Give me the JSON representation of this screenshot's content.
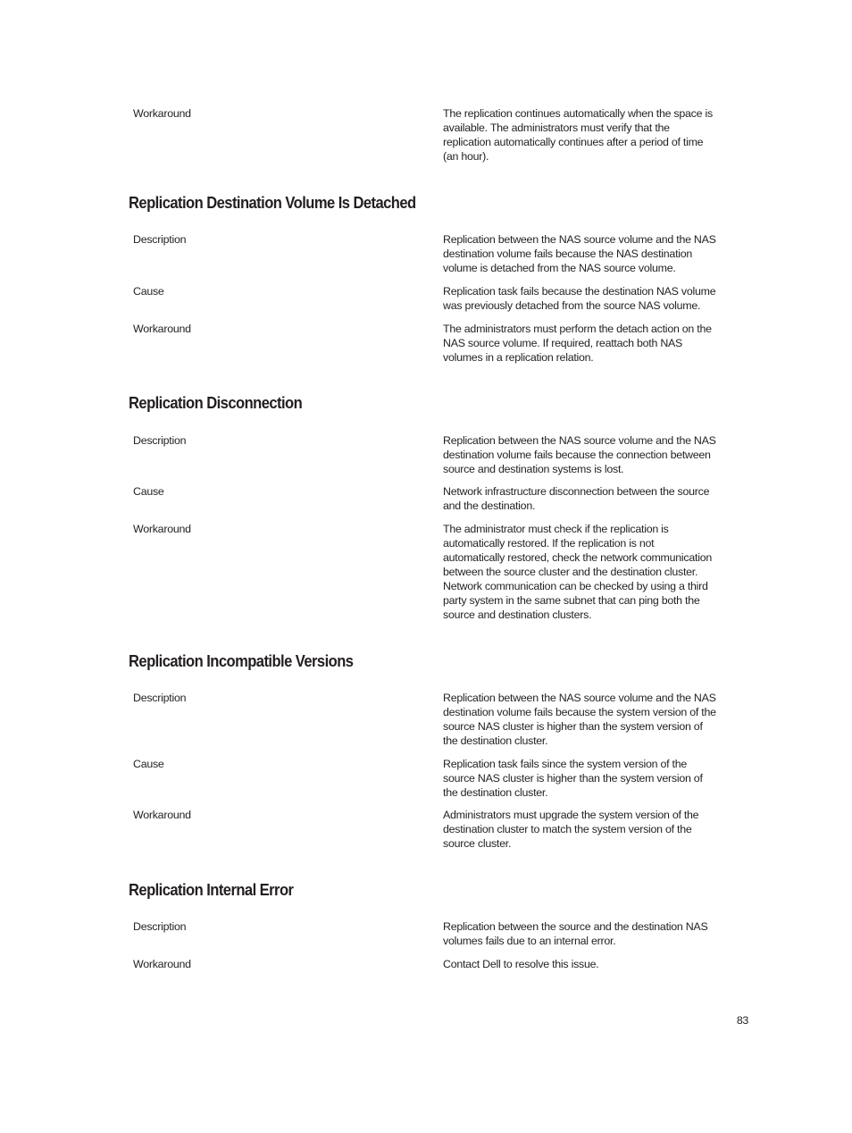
{
  "page_number": "83",
  "intro_row": {
    "label": "Workaround",
    "lines": [
      "The replication continues automatically when the space is",
      "available. The administrators must verify that the",
      "replication automatically continues after a period of time",
      "(an hour)."
    ]
  },
  "sections": [
    {
      "title": "Replication Destination Volume Is Detached",
      "rows": [
        {
          "label": "Description",
          "lines": [
            "Replication between the NAS source volume and the NAS",
            "destination volume fails because the NAS destination",
            "volume is detached from the NAS source volume."
          ]
        },
        {
          "label": "Cause",
          "lines": [
            "Replication task fails because the destination NAS volume",
            "was previously detached from the source NAS volume."
          ]
        },
        {
          "label": "Workaround",
          "lines": [
            "The administrators must perform the detach action on the",
            "NAS source volume. If required, reattach both NAS",
            "volumes in a replication relation."
          ]
        }
      ]
    },
    {
      "title": "Replication Disconnection",
      "rows": [
        {
          "label": "Description",
          "lines": [
            "Replication between the NAS source volume and the NAS",
            "destination volume fails because the connection between",
            "source and destination systems is lost."
          ]
        },
        {
          "label": "Cause",
          "lines": [
            "Network infrastructure disconnection between the source",
            "and the destination."
          ]
        },
        {
          "label": "Workaround",
          "lines": [
            "The administrator must check if the replication is",
            "automatically restored. If the replication is not",
            "automatically restored, check the network communication",
            "between the source cluster and the destination cluster.",
            "Network communication can be checked by using a third",
            "party system in the same subnet that can ping both the",
            "source and destination clusters."
          ]
        }
      ]
    },
    {
      "title": "Replication Incompatible Versions",
      "rows": [
        {
          "label": "Description",
          "lines": [
            "Replication between the NAS source volume and the NAS",
            "destination volume fails because the system version of the",
            "source NAS cluster is higher than the system version of",
            "the destination cluster."
          ]
        },
        {
          "label": "Cause",
          "lines": [
            "Replication task fails since the system version of the",
            "source NAS cluster is higher than the system version of",
            "the destination cluster."
          ]
        },
        {
          "label": "Workaround",
          "lines": [
            "Administrators must upgrade the system version of the",
            "destination cluster to match the system version of the",
            "source cluster."
          ]
        }
      ]
    },
    {
      "title": "Replication Internal Error",
      "rows": [
        {
          "label": "Description",
          "lines": [
            "Replication between the source and the destination NAS",
            "volumes fails due to an internal error."
          ]
        },
        {
          "label": "Workaround",
          "lines": [
            "Contact Dell to resolve this issue."
          ]
        }
      ]
    }
  ]
}
